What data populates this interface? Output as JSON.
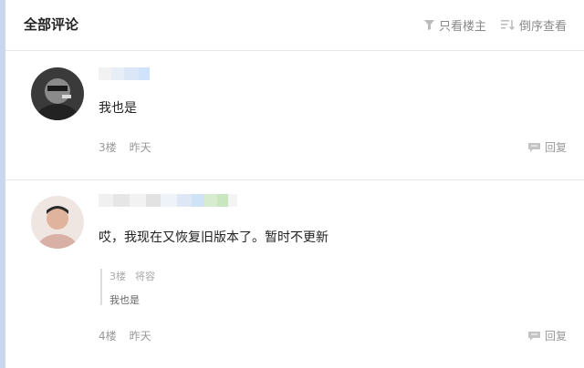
{
  "header": {
    "title": "全部评论",
    "filter_label": "只看楼主",
    "sort_label": "倒序查看"
  },
  "comments": [
    {
      "text": "我也是",
      "floor": "3楼",
      "time": "昨天",
      "reply_label": "回复"
    },
    {
      "text": "哎，我现在又恢复旧版本了。暂时不更新",
      "floor": "4楼",
      "time": "昨天",
      "reply_label": "回复",
      "quote": {
        "floor": "3楼",
        "author": "将容",
        "text": "我也是"
      }
    }
  ],
  "colors": {
    "accent_border": "#c9d7ec",
    "muted_text": "#999999"
  }
}
